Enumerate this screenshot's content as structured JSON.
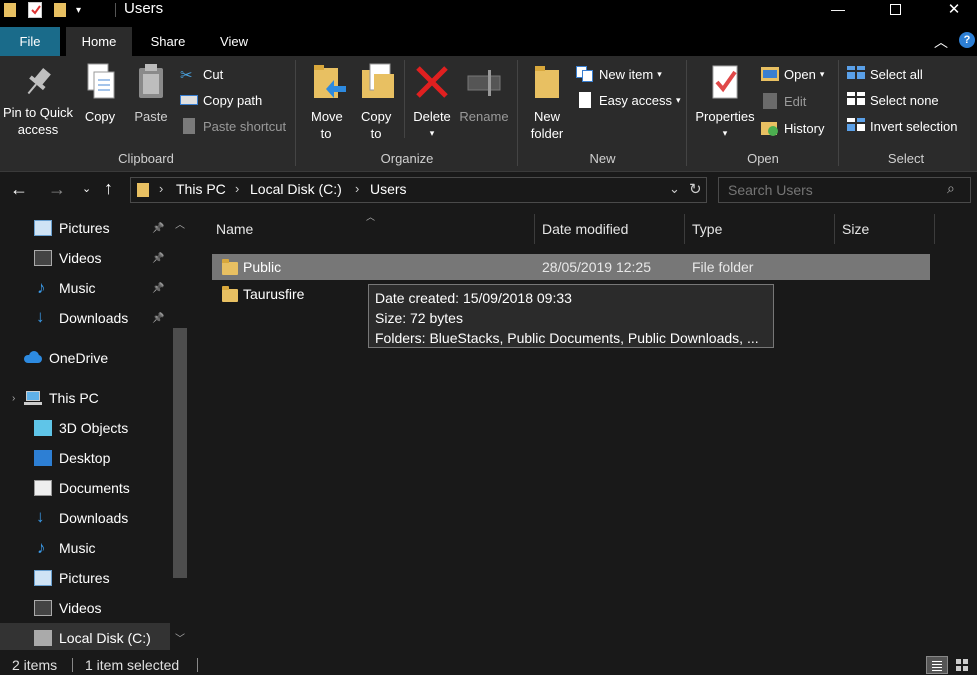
{
  "window": {
    "title": "Users",
    "minimize_glyph": "—",
    "maximize_glyph": "☐",
    "close_glyph": "✕",
    "quick_access_icons": [
      "folder-icon",
      "checkmark-properties-icon",
      "new-folder-icon",
      "customize-dropdown-icon"
    ]
  },
  "tabs": {
    "file": "File",
    "home": "Home",
    "share": "Share",
    "view": "View"
  },
  "ribbon": {
    "clipboard": {
      "label": "Clipboard",
      "pin_to_quick_access": "Pin to Quick access",
      "copy": "Copy",
      "paste": "Paste",
      "cut": "Cut",
      "copy_path": "Copy path",
      "paste_shortcut": "Paste shortcut"
    },
    "organize": {
      "label": "Organize",
      "move_to": "Move to",
      "copy_to": "Copy to",
      "delete": "Delete",
      "rename": "Rename"
    },
    "new": {
      "label": "New",
      "new_folder": "New folder",
      "new_item": "New item",
      "easy_access": "Easy access"
    },
    "open": {
      "label": "Open",
      "properties": "Properties",
      "open": "Open",
      "edit": "Edit",
      "history": "History"
    },
    "select": {
      "label": "Select",
      "select_all": "Select all",
      "select_none": "Select none",
      "invert_selection": "Invert selection"
    }
  },
  "address": {
    "breadcrumbs": [
      "This PC",
      "Local Disk (C:)",
      "Users"
    ],
    "search_placeholder": "Search Users"
  },
  "nav": {
    "items": [
      {
        "label": "Pictures",
        "icon": "pictures-icon",
        "pinned": true
      },
      {
        "label": "Videos",
        "icon": "videos-icon",
        "pinned": true
      },
      {
        "label": "Music",
        "icon": "music-icon",
        "pinned": true
      },
      {
        "label": "Downloads",
        "icon": "downloads-icon",
        "pinned": true
      },
      {
        "label": "OneDrive",
        "icon": "onedrive-icon",
        "pinned": false
      },
      {
        "label": "This PC",
        "icon": "this-pc-icon",
        "pinned": false
      },
      {
        "label": "3D Objects",
        "icon": "3d-objects-icon",
        "pinned": false
      },
      {
        "label": "Desktop",
        "icon": "desktop-icon",
        "pinned": false
      },
      {
        "label": "Documents",
        "icon": "documents-icon",
        "pinned": false
      },
      {
        "label": "Downloads",
        "icon": "downloads-icon",
        "pinned": false
      },
      {
        "label": "Music",
        "icon": "music-icon",
        "pinned": false
      },
      {
        "label": "Pictures",
        "icon": "pictures-icon",
        "pinned": false
      },
      {
        "label": "Videos",
        "icon": "videos-icon",
        "pinned": false
      },
      {
        "label": "Local Disk (C:)",
        "icon": "local-disk-icon",
        "pinned": false,
        "selected": true
      }
    ]
  },
  "columns": {
    "name": "Name",
    "date_modified": "Date modified",
    "type": "Type",
    "size": "Size"
  },
  "files": [
    {
      "name": "Public",
      "date_modified": "28/05/2019 12:25",
      "type": "File folder",
      "size": "",
      "selected": true
    },
    {
      "name": "Taurusfire",
      "date_modified": "",
      "type": "",
      "size": "",
      "selected": false
    }
  ],
  "tooltip": {
    "date_created": "Date created: 15/09/2018 09:33",
    "size": "Size: 72 bytes",
    "folders": "Folders: BlueStacks, Public Documents, Public Downloads, ..."
  },
  "status": {
    "item_count": "2 items",
    "selection": "1 item selected"
  },
  "colors": {
    "accent_file_tab": "#1a6b8a",
    "background": "#191919",
    "ribbon": "#2b2b2b",
    "selected_row": "#777777"
  }
}
